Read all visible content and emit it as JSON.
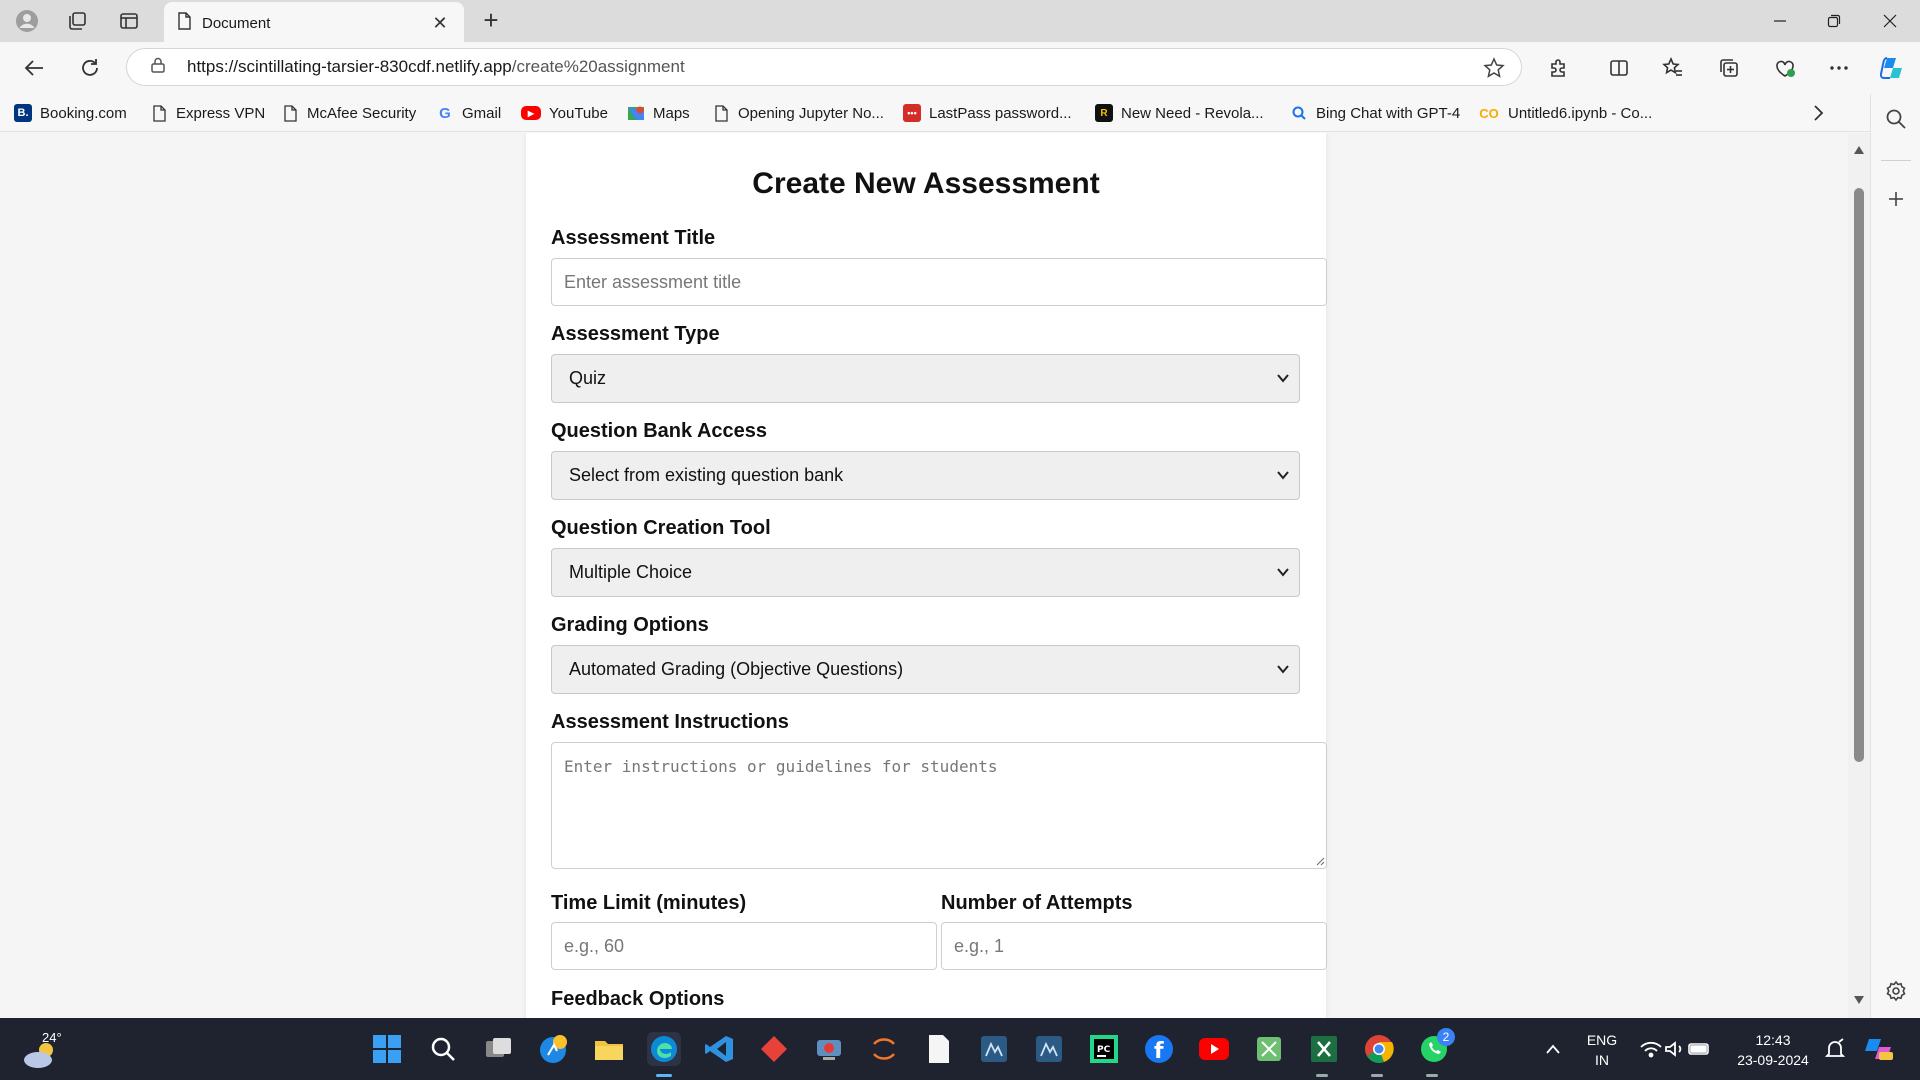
{
  "browser": {
    "tab_title": "Document",
    "url_host": "https://scintillating-tarsier-830cdf.netlify.app",
    "url_path": "/create%20assignment"
  },
  "favorites": [
    {
      "label": "Booking.com",
      "icon": "booking-icon",
      "color": "#003580"
    },
    {
      "label": "Express VPN",
      "icon": "page-icon"
    },
    {
      "label": "McAfee Security",
      "icon": "page-icon"
    },
    {
      "label": "Gmail",
      "icon": "google-icon"
    },
    {
      "label": "YouTube",
      "icon": "youtube-icon",
      "color": "#ff0000"
    },
    {
      "label": "Maps",
      "icon": "maps-icon"
    },
    {
      "label": "Opening Jupyter No...",
      "icon": "page-icon"
    },
    {
      "label": "LastPass password...",
      "icon": "lastpass-icon",
      "color": "#d32d27"
    },
    {
      "label": "New Need - Revola...",
      "icon": "revola-icon"
    },
    {
      "label": "Bing Chat with GPT-4",
      "icon": "bing-search-icon"
    },
    {
      "label": "Untitled6.ipynb - Co...",
      "icon": "colab-icon",
      "color": "#f9ab00"
    }
  ],
  "form": {
    "heading": "Create New Assessment",
    "title_label": "Assessment Title",
    "title_placeholder": "Enter assessment title",
    "type_label": "Assessment Type",
    "type_value": "Quiz",
    "bank_label": "Question Bank Access",
    "bank_value": "Select from existing question bank",
    "tool_label": "Question Creation Tool",
    "tool_value": "Multiple Choice",
    "grading_label": "Grading Options",
    "grading_value": "Automated Grading (Objective Questions)",
    "instructions_label": "Assessment Instructions",
    "instructions_placeholder": "Enter instructions or guidelines for students",
    "time_label": "Time Limit (minutes)",
    "time_placeholder": "e.g., 60",
    "attempts_label": "Number of Attempts",
    "attempts_placeholder": "e.g., 1",
    "feedback_label": "Feedback Options"
  },
  "taskbar": {
    "weather_temp": "24°",
    "lang_line1": "ENG",
    "lang_line2": "IN",
    "time": "12:43",
    "date": "23-09-2024",
    "whatsapp_badge": "2"
  },
  "colors": {
    "accent_edge": "#0078d4",
    "taskbar_bg": "#1f2330"
  }
}
